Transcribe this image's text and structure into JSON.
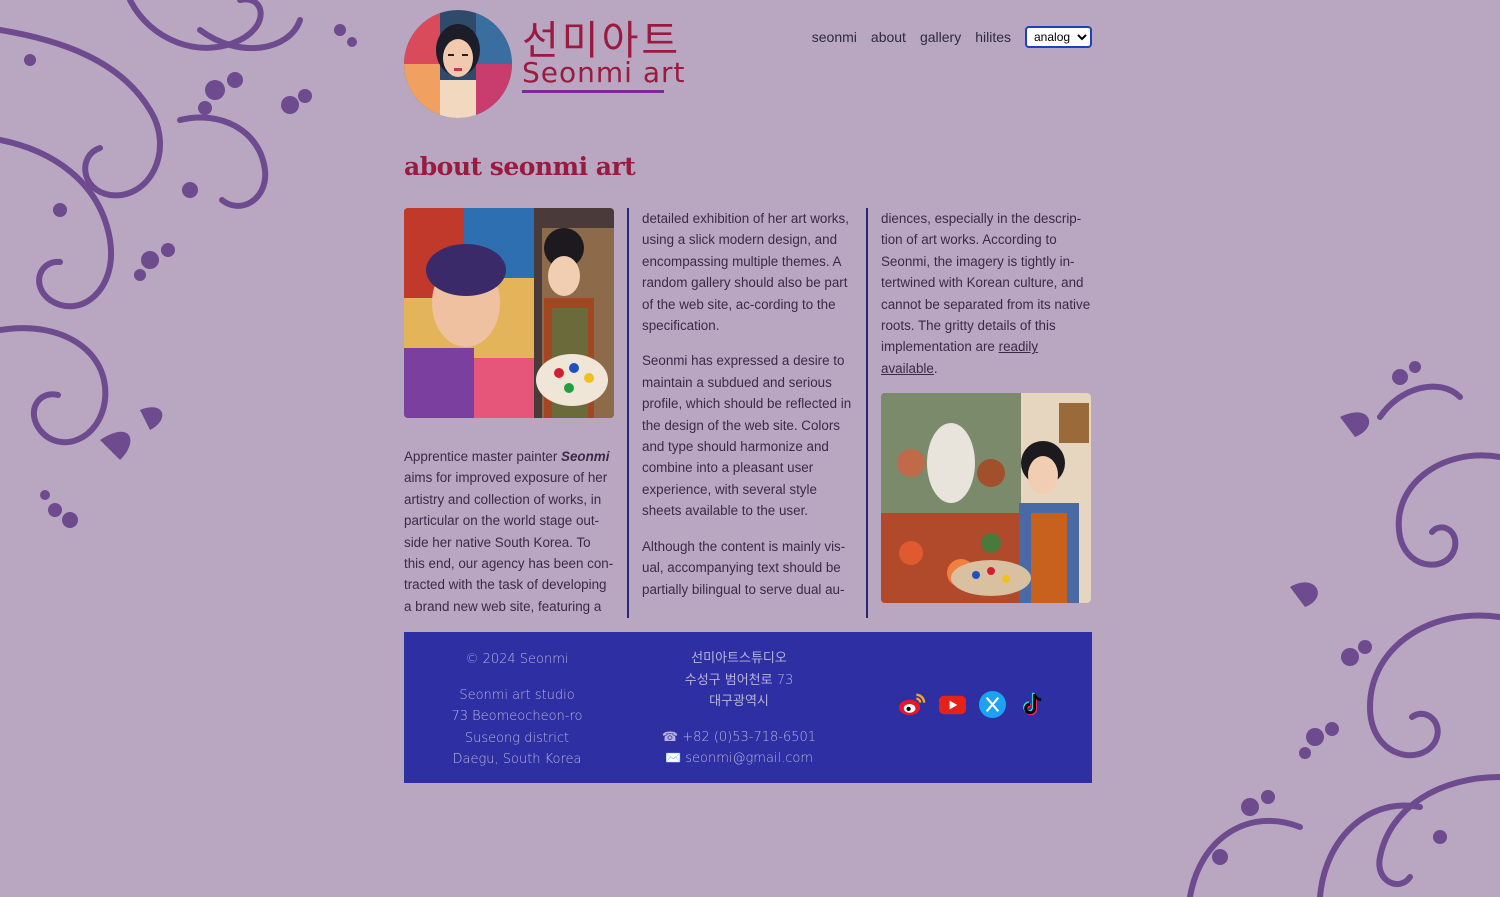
{
  "brand": {
    "name_ko": "선미아트",
    "name_en": "Seonmi art"
  },
  "nav": {
    "items": [
      "seonmi",
      "about",
      "gallery",
      "hilites"
    ],
    "theme_selected": "analog"
  },
  "page": {
    "title": "about seonmi art"
  },
  "content": {
    "col1_lead": "Apprentice master painter ",
    "col1_name": "Seonmi",
    "col1_rest": " aims for improved exposure of her artistry and collection of works, in particular on the world stage out-side her native South Korea. To this end, our agency has been con-tracted with the task of developing a brand new web site, featuring a",
    "col2_p1": "detailed exhibition of her art works, using a slick modern design, and encompassing multiple themes. A random gallery should also be part of the web site, ac-cording to the specification.",
    "col2_p2": "Seonmi has expressed a desire to maintain a subdued and serious profile, which should be reflected in the design of the web site. Colors and type should harmonize and combine into a pleasant user experience, with several style sheets available to the user.",
    "col2_p3": "Although the content is mainly vis-ual, accompanying text should be partially bilingual to serve dual au-",
    "col3_p1": "diences, especially in the descrip-tion of art works. According to Seonmi, the imagery is tightly in-tertwined with Korean culture, and cannot be separated from its native roots. The gritty details of this implementation are ",
    "col3_link": "readily available",
    "col3_end": "."
  },
  "footer": {
    "copyright": "© 2024 Seonmi",
    "address_en": [
      "Seonmi art studio",
      "73 Beomeocheon-ro",
      "Suseong district",
      "Daegu, South Korea"
    ],
    "address_ko": [
      "선미아트스튜디오",
      "수성구 범어천로 73",
      "대구광역시"
    ],
    "phone": "☎ +82 (0)53-718-6501",
    "email": "✉️ seonmi@gmail.com",
    "socials": [
      "weibo-icon",
      "youtube-icon",
      "x-icon",
      "tiktok-icon"
    ]
  },
  "colors": {
    "background": "#b9a7c2",
    "accent": "#9a1a40",
    "footer": "#2e2fa3",
    "ornament": "#6e4a8e"
  }
}
